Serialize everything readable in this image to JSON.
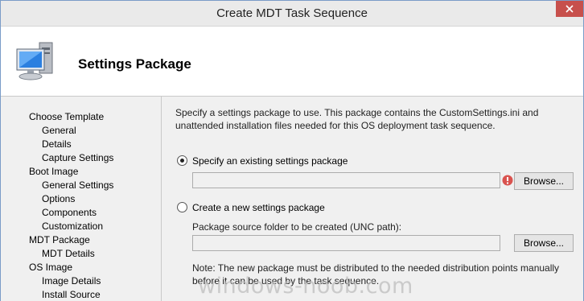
{
  "window": {
    "title": "Create MDT Task Sequence"
  },
  "header": {
    "title": "Settings Package",
    "icon": "computer-icon"
  },
  "sidebar": {
    "items": [
      {
        "label": "Choose Template",
        "level": 0
      },
      {
        "label": "General",
        "level": 1
      },
      {
        "label": "Details",
        "level": 1
      },
      {
        "label": "Capture Settings",
        "level": 1
      },
      {
        "label": "Boot Image",
        "level": 0
      },
      {
        "label": "General Settings",
        "level": 1
      },
      {
        "label": "Options",
        "level": 1
      },
      {
        "label": "Components",
        "level": 1
      },
      {
        "label": "Customization",
        "level": 1
      },
      {
        "label": "MDT Package",
        "level": 0
      },
      {
        "label": "MDT Details",
        "level": 1
      },
      {
        "label": "OS Image",
        "level": 0
      },
      {
        "label": "Image Details",
        "level": 1
      },
      {
        "label": "Install Source",
        "level": 1
      }
    ]
  },
  "content": {
    "intro": "Specify a settings package to use.  This package contains the CustomSettings.ini and unattended installation files needed for this OS deployment task sequence.",
    "option_existing": {
      "label": "Specify an existing settings package",
      "selected": true,
      "value": "",
      "browse_label": "Browse..."
    },
    "option_new": {
      "label": "Create a new settings package",
      "selected": false,
      "folder_label": "Package source folder to be created (UNC path):",
      "value": "",
      "browse_label": "Browse..."
    },
    "note": "Note: The new package must be distributed to the needed distribution points manually before it can be used by the task sequence."
  },
  "watermark": "windows-noob.com",
  "colors": {
    "close_button": "#c7504c",
    "error_icon": "#d9534f",
    "panel_bg": "#f0f0f0"
  }
}
